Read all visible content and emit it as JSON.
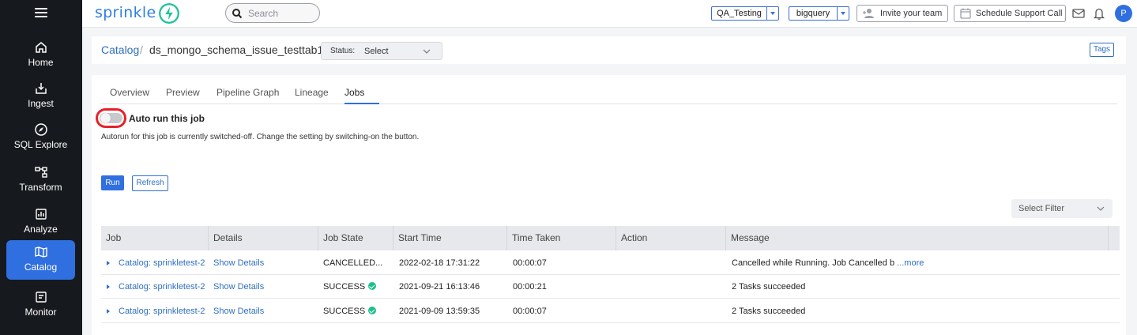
{
  "sidebar": {
    "items": [
      {
        "label": "Home",
        "icon": "home-icon"
      },
      {
        "label": "Ingest",
        "icon": "ingest-icon"
      },
      {
        "label": "SQL Explore",
        "icon": "compass-icon"
      },
      {
        "label": "Transform",
        "icon": "transform-icon"
      },
      {
        "label": "Analyze",
        "icon": "chart-icon"
      },
      {
        "label": "Catalog",
        "icon": "map-icon",
        "active": true
      },
      {
        "label": "Monitor",
        "icon": "monitor-icon"
      }
    ]
  },
  "header": {
    "logo": "sprinkle",
    "search_placeholder": "Search",
    "workspace": "QA_Testing",
    "warehouse": "bigquery",
    "invite_label": "Invite your team",
    "schedule_label": "Schedule Support Call",
    "avatar_initial": "P"
  },
  "breadcrumb": {
    "root": "Catalog",
    "separator": "/",
    "current": "ds_mongo_schema_issue_testtab1"
  },
  "status": {
    "label": "Status:",
    "value": "Select"
  },
  "tags_label": "Tags",
  "tabs": [
    "Overview",
    "Preview",
    "Pipeline Graph",
    "Lineage",
    "Jobs"
  ],
  "active_tab": "Jobs",
  "autorun": {
    "title": "Auto run this job",
    "description": "Autorun for this job is currently switched-off. Change the setting by switching-on the button.",
    "enabled": false
  },
  "actions": {
    "run": "Run",
    "refresh": "Refresh"
  },
  "filter_placeholder": "Select Filter",
  "table": {
    "columns": [
      "Job",
      "Details",
      "Job State",
      "Start Time",
      "Time Taken",
      "Action",
      "Message"
    ],
    "rows": [
      {
        "job": "Catalog: sprinkletest-2",
        "details": "Show Details",
        "state": "CANCELLED...",
        "state_ok": false,
        "start": "2022-02-18 17:31:22",
        "taken": "00:00:07",
        "action": "",
        "message": "Cancelled while Running. Job Cancelled b",
        "more": "...more"
      },
      {
        "job": "Catalog: sprinkletest-2",
        "details": "Show Details",
        "state": "SUCCESS",
        "state_ok": true,
        "start": "2021-09-21 16:13:46",
        "taken": "00:00:21",
        "action": "",
        "message": "2 Tasks succeeded",
        "more": ""
      },
      {
        "job": "Catalog: sprinkletest-2",
        "details": "Show Details",
        "state": "SUCCESS",
        "state_ok": true,
        "start": "2021-09-09 13:59:35",
        "taken": "00:00:07",
        "action": "",
        "message": "2 Tasks succeeded",
        "more": ""
      }
    ]
  },
  "colors": {
    "accent": "#2f6fe0",
    "sidebar": "#16191d",
    "success": "#1fbf8f",
    "highlight": "#e8202a"
  }
}
